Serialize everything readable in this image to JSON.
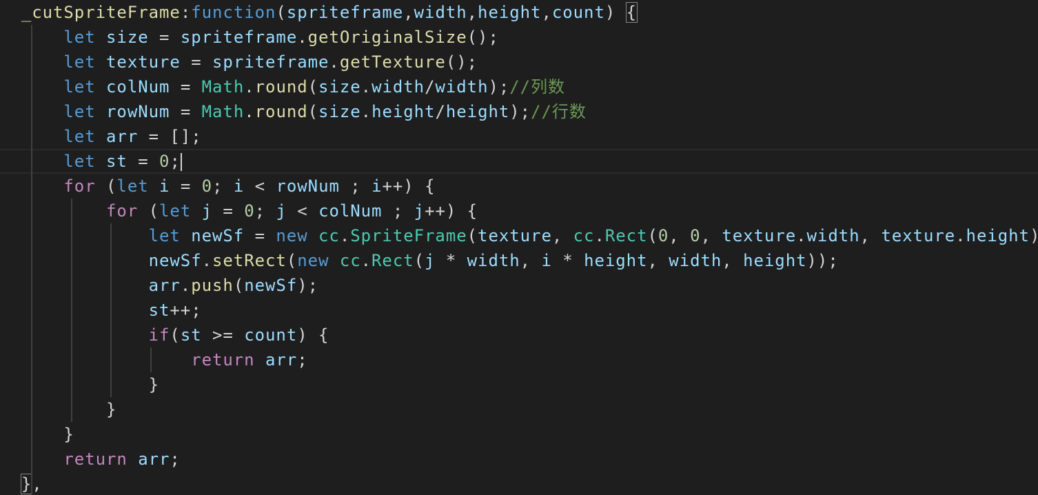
{
  "editor": {
    "lines": [
      [
        [
          "pun",
          "  "
        ],
        [
          "fn",
          "_cutSpriteFrame"
        ],
        [
          "pun",
          ":"
        ],
        [
          "kw",
          "function"
        ],
        [
          "pun",
          "("
        ],
        [
          "var",
          "spriteframe"
        ],
        [
          "pun",
          ","
        ],
        [
          "var",
          "width"
        ],
        [
          "pun",
          ","
        ],
        [
          "var",
          "height"
        ],
        [
          "pun",
          ","
        ],
        [
          "var",
          "count"
        ],
        [
          "pun",
          ") "
        ],
        [
          "brk",
          "{"
        ]
      ],
      [
        [
          "pun",
          "      "
        ],
        [
          "kw",
          "let"
        ],
        [
          "pun",
          " "
        ],
        [
          "var",
          "size"
        ],
        [
          "pun",
          " = "
        ],
        [
          "var",
          "spriteframe"
        ],
        [
          "pun",
          "."
        ],
        [
          "fn",
          "getOriginalSize"
        ],
        [
          "pun",
          "();"
        ]
      ],
      [
        [
          "pun",
          "      "
        ],
        [
          "kw",
          "let"
        ],
        [
          "pun",
          " "
        ],
        [
          "var",
          "texture"
        ],
        [
          "pun",
          " = "
        ],
        [
          "var",
          "spriteframe"
        ],
        [
          "pun",
          "."
        ],
        [
          "fn",
          "getTexture"
        ],
        [
          "pun",
          "();"
        ]
      ],
      [
        [
          "pun",
          "      "
        ],
        [
          "kw",
          "let"
        ],
        [
          "pun",
          " "
        ],
        [
          "var",
          "colNum"
        ],
        [
          "pun",
          " = "
        ],
        [
          "cls",
          "Math"
        ],
        [
          "pun",
          "."
        ],
        [
          "fn",
          "round"
        ],
        [
          "pun",
          "("
        ],
        [
          "var",
          "size"
        ],
        [
          "pun",
          "."
        ],
        [
          "var",
          "width"
        ],
        [
          "pun",
          "/"
        ],
        [
          "var",
          "width"
        ],
        [
          "pun",
          ");"
        ],
        [
          "cmt",
          "//列数"
        ]
      ],
      [
        [
          "pun",
          "      "
        ],
        [
          "kw",
          "let"
        ],
        [
          "pun",
          " "
        ],
        [
          "var",
          "rowNum"
        ],
        [
          "pun",
          " = "
        ],
        [
          "cls",
          "Math"
        ],
        [
          "pun",
          "."
        ],
        [
          "fn",
          "round"
        ],
        [
          "pun",
          "("
        ],
        [
          "var",
          "size"
        ],
        [
          "pun",
          "."
        ],
        [
          "var",
          "height"
        ],
        [
          "pun",
          "/"
        ],
        [
          "var",
          "height"
        ],
        [
          "pun",
          ");"
        ],
        [
          "cmt",
          "//行数"
        ]
      ],
      [
        [
          "pun",
          "      "
        ],
        [
          "kw",
          "let"
        ],
        [
          "pun",
          " "
        ],
        [
          "var",
          "arr"
        ],
        [
          "pun",
          " = [];"
        ]
      ],
      [
        [
          "pun",
          "      "
        ],
        [
          "kw",
          "let"
        ],
        [
          "pun",
          " "
        ],
        [
          "var",
          "st"
        ],
        [
          "pun",
          " = "
        ],
        [
          "num",
          "0"
        ],
        [
          "pun",
          ";"
        ],
        [
          "cursor",
          ""
        ]
      ],
      [
        [
          "pun",
          "      "
        ],
        [
          "ctl",
          "for"
        ],
        [
          "pun",
          " ("
        ],
        [
          "kw",
          "let"
        ],
        [
          "pun",
          " "
        ],
        [
          "var",
          "i"
        ],
        [
          "pun",
          " = "
        ],
        [
          "num",
          "0"
        ],
        [
          "pun",
          "; "
        ],
        [
          "var",
          "i"
        ],
        [
          "pun",
          " < "
        ],
        [
          "var",
          "rowNum"
        ],
        [
          "pun",
          " ; "
        ],
        [
          "var",
          "i"
        ],
        [
          "pun",
          "++) {"
        ]
      ],
      [
        [
          "pun",
          "          "
        ],
        [
          "ctl",
          "for"
        ],
        [
          "pun",
          " ("
        ],
        [
          "kw",
          "let"
        ],
        [
          "pun",
          " "
        ],
        [
          "var",
          "j"
        ],
        [
          "pun",
          " = "
        ],
        [
          "num",
          "0"
        ],
        [
          "pun",
          "; "
        ],
        [
          "var",
          "j"
        ],
        [
          "pun",
          " < "
        ],
        [
          "var",
          "colNum"
        ],
        [
          "pun",
          " ; "
        ],
        [
          "var",
          "j"
        ],
        [
          "pun",
          "++) {"
        ]
      ],
      [
        [
          "pun",
          "              "
        ],
        [
          "kw",
          "let"
        ],
        [
          "pun",
          " "
        ],
        [
          "var",
          "newSf"
        ],
        [
          "pun",
          " = "
        ],
        [
          "kw",
          "new"
        ],
        [
          "pun",
          " "
        ],
        [
          "cls",
          "cc"
        ],
        [
          "pun",
          "."
        ],
        [
          "cls",
          "SpriteFrame"
        ],
        [
          "pun",
          "("
        ],
        [
          "var",
          "texture"
        ],
        [
          "pun",
          ", "
        ],
        [
          "cls",
          "cc"
        ],
        [
          "pun",
          "."
        ],
        [
          "cls",
          "Rect"
        ],
        [
          "pun",
          "("
        ],
        [
          "num",
          "0"
        ],
        [
          "pun",
          ", "
        ],
        [
          "num",
          "0"
        ],
        [
          "pun",
          ", "
        ],
        [
          "var",
          "texture"
        ],
        [
          "pun",
          "."
        ],
        [
          "var",
          "width"
        ],
        [
          "pun",
          ", "
        ],
        [
          "var",
          "texture"
        ],
        [
          "pun",
          "."
        ],
        [
          "var",
          "height"
        ],
        [
          "pun",
          "));"
        ]
      ],
      [
        [
          "pun",
          "              "
        ],
        [
          "var",
          "newSf"
        ],
        [
          "pun",
          "."
        ],
        [
          "fn",
          "setRect"
        ],
        [
          "pun",
          "("
        ],
        [
          "kw",
          "new"
        ],
        [
          "pun",
          " "
        ],
        [
          "cls",
          "cc"
        ],
        [
          "pun",
          "."
        ],
        [
          "cls",
          "Rect"
        ],
        [
          "pun",
          "("
        ],
        [
          "var",
          "j"
        ],
        [
          "pun",
          " * "
        ],
        [
          "var",
          "width"
        ],
        [
          "pun",
          ", "
        ],
        [
          "var",
          "i"
        ],
        [
          "pun",
          " * "
        ],
        [
          "var",
          "height"
        ],
        [
          "pun",
          ", "
        ],
        [
          "var",
          "width"
        ],
        [
          "pun",
          ", "
        ],
        [
          "var",
          "height"
        ],
        [
          "pun",
          "));"
        ]
      ],
      [
        [
          "pun",
          "              "
        ],
        [
          "var",
          "arr"
        ],
        [
          "pun",
          "."
        ],
        [
          "fn",
          "push"
        ],
        [
          "pun",
          "("
        ],
        [
          "var",
          "newSf"
        ],
        [
          "pun",
          ");"
        ]
      ],
      [
        [
          "pun",
          "              "
        ],
        [
          "var",
          "st"
        ],
        [
          "pun",
          "++;"
        ]
      ],
      [
        [
          "pun",
          "              "
        ],
        [
          "ctl",
          "if"
        ],
        [
          "pun",
          "("
        ],
        [
          "var",
          "st"
        ],
        [
          "pun",
          " >= "
        ],
        [
          "var",
          "count"
        ],
        [
          "pun",
          ") {"
        ]
      ],
      [
        [
          "pun",
          "                  "
        ],
        [
          "ctl",
          "return"
        ],
        [
          "pun",
          " "
        ],
        [
          "var",
          "arr"
        ],
        [
          "pun",
          ";"
        ]
      ],
      [
        [
          "pun",
          "              }"
        ]
      ],
      [
        [
          "pun",
          "          }"
        ]
      ],
      [
        [
          "pun",
          "      }"
        ]
      ],
      [
        [
          "pun",
          "      "
        ],
        [
          "ctl",
          "return"
        ],
        [
          "pun",
          " "
        ],
        [
          "var",
          "arr"
        ],
        [
          "pun",
          ";"
        ]
      ],
      [
        [
          "pun",
          "  "
        ],
        [
          "brk",
          "}"
        ],
        [
          "pun",
          ","
        ]
      ]
    ]
  }
}
